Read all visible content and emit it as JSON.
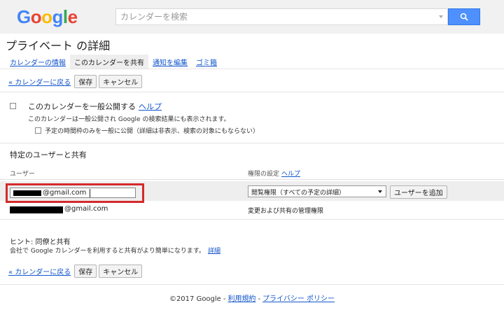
{
  "header": {
    "logo": "Google",
    "search_placeholder": "カレンダーを検索"
  },
  "page": {
    "title": "プライベート の詳細"
  },
  "tabs": [
    {
      "label": "カレンダーの情報",
      "active": false
    },
    {
      "label": "このカレンダーを共有",
      "active": true
    },
    {
      "label": "通知を編集",
      "active": false
    },
    {
      "label": "ゴミ箱",
      "active": false
    }
  ],
  "actions": {
    "back": "« カレンダーに戻る",
    "save": "保存",
    "cancel": "キャンセル"
  },
  "public": {
    "label": "このカレンダーを一般公開する",
    "help": "ヘルプ",
    "description": "このカレンダーは一般公開され Google の検索結果にも表示されます。",
    "busy_only_label": "予定の時間枠のみを一般に公開（詳細は非表示、検索の対象にもならない）"
  },
  "share": {
    "title": "特定のユーザーと共有",
    "col_user": "ユーザー",
    "col_permission": "権限の設定",
    "col_help": "ヘルプ",
    "new_email_value": "@gmail.com",
    "permission_selected": "閲覧権限（すべての予定の詳細）",
    "add_user": "ユーザーを追加",
    "members": [
      {
        "email": "@gmail.com",
        "permission": "変更および共有の管理権限"
      }
    ]
  },
  "hint": {
    "title": "ヒント: 同僚と共有",
    "text": "会社で Google カレンダーを利用すると共有がより簡単になります。",
    "link": "詳細"
  },
  "footer": {
    "copyright": "©2017 Google",
    "terms": "利用規約",
    "privacy": "プライバシー ポリシー",
    "separator": "-"
  },
  "colors": {
    "accent_blue": "#4d90fe",
    "link": "#1155cc",
    "highlight_red": "#d42a2a"
  }
}
